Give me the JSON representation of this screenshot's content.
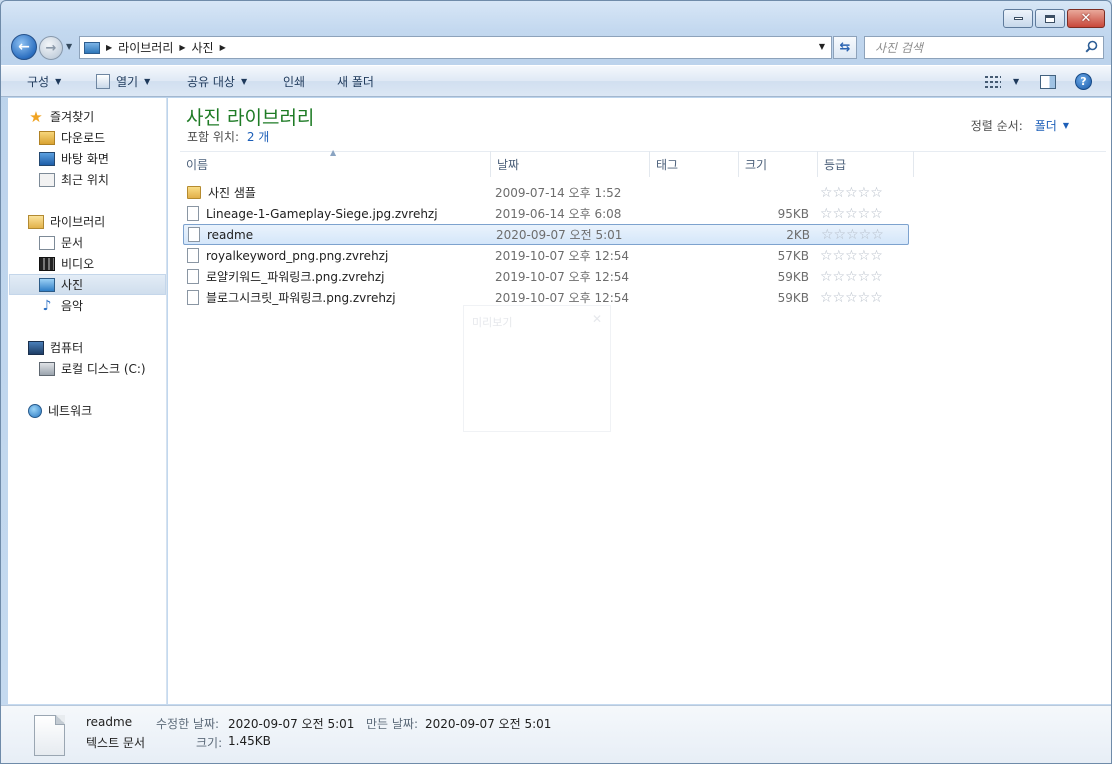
{
  "window": {
    "caption": {
      "minimize": "minimize",
      "maximize": "maximize",
      "close": "close"
    }
  },
  "address": {
    "crumbs": [
      "라이브러리",
      "사진"
    ]
  },
  "search": {
    "placeholder": "사진 검색"
  },
  "toolbar": {
    "organize": "구성",
    "open": "열기",
    "share": "공유 대상",
    "print": "인쇄",
    "new_folder": "새 폴더"
  },
  "nav": {
    "favorites": "즐겨찾기",
    "downloads": "다운로드",
    "desktop": "바탕 화면",
    "recent": "최근 위치",
    "libraries": "라이브러리",
    "documents": "문서",
    "videos": "비디오",
    "pictures": "사진",
    "music": "음악",
    "computer": "컴퓨터",
    "local_disk": "로컬 디스크 (C:)",
    "network": "네트워크"
  },
  "library": {
    "title": "사진 라이브러리",
    "includes_label": "포함 위치:",
    "includes_count": "2 개",
    "sort_label": "정렬 순서:",
    "sort_value": "폴더"
  },
  "columns": {
    "name": "이름",
    "date": "날짜",
    "tag": "태그",
    "size": "크기",
    "rating": "등급"
  },
  "files": [
    {
      "name": "사진 샘플",
      "date": "2009-07-14 오후 1:52",
      "size": "",
      "type": "folder"
    },
    {
      "name": "Lineage-1-Gameplay-Siege.jpg.zvrehzj",
      "date": "2019-06-14 오후 6:08",
      "size": "95KB",
      "type": "file"
    },
    {
      "name": "readme",
      "date": "2020-09-07 오전 5:01",
      "size": "2KB",
      "type": "file"
    },
    {
      "name": "royalkeyword_png.png.zvrehzj",
      "date": "2019-10-07 오후 12:54",
      "size": "57KB",
      "type": "file"
    },
    {
      "name": "로얄키워드_파워링크.png.zvrehzj",
      "date": "2019-10-07 오후 12:54",
      "size": "59KB",
      "type": "file"
    },
    {
      "name": "블로그시크릿_파워링크.png.zvrehzj",
      "date": "2019-10-07 오후 12:54",
      "size": "59KB",
      "type": "file"
    }
  ],
  "ghost_popup": {
    "title": "미리보기"
  },
  "details": {
    "name": "readme",
    "type": "텍스트 문서",
    "modified_label": "수정한 날짜:",
    "modified": "2020-09-07 오전 5:01",
    "created_label": "만든 날짜:",
    "created": "2020-09-07 오전 5:01",
    "size_label": "크기:",
    "size": "1.45KB"
  }
}
